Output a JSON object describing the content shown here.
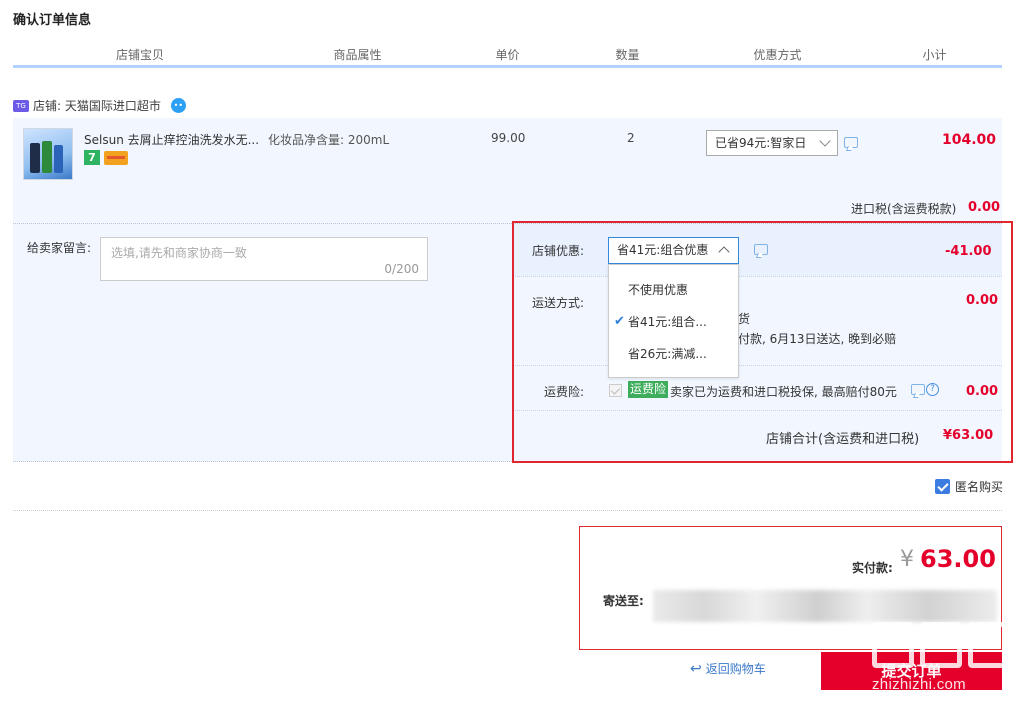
{
  "page": {
    "title": "确认订单信息"
  },
  "columns": [
    "店铺宝贝",
    "商品属性",
    "单价",
    "数量",
    "优惠方式",
    "小计"
  ],
  "shop": {
    "label": "店铺: 天猫国际进口超市",
    "badge_icon": "tmall-global-icon",
    "chat_icon": "wangwang-icon"
  },
  "item": {
    "title": "Selsun 去屑止痒控油洗发水无...",
    "attr": "化妆品净含量: 200mL",
    "price": "99.00",
    "qty": "2",
    "promo": "已省94元:智家日",
    "subtotal": "104.00",
    "tags": [
      "7",
      "card-tag"
    ]
  },
  "tax": {
    "label": "进口税(含运费税款)",
    "value": "0.00"
  },
  "message": {
    "label": "给卖家留言:",
    "placeholder": "选填,请先和商家协商一致",
    "counter": "0/200"
  },
  "shop_panel": {
    "discount_label": "店铺优惠:",
    "discount_selected": "省41元:组合优惠",
    "discount_value": "-41.00",
    "shipping_label": "运送方式:",
    "shipping_value": "0.00",
    "shipping_line1": "货",
    "shipping_line2": "付款, 6月13日送达, 晚到必赔",
    "insurance_label": "运费险:",
    "insurance_badge": "运费险",
    "insurance_text": "卖家已为运费和进口税投保, 最高赔付80元",
    "insurance_value": "0.00",
    "total_label": "店铺合计(含运费和进口税)",
    "total_value": "¥63.00"
  },
  "dropdown": {
    "options": [
      "不使用优惠",
      "省41元:组合...",
      "省26元:满减..."
    ],
    "selected_index": 1
  },
  "anonymous": {
    "label": "匿名购买",
    "checked": true
  },
  "payment": {
    "paid_label": "实付款:",
    "currency": "¥",
    "amount": "63.00",
    "ship_to_label": "寄送至:"
  },
  "actions": {
    "back_label": "返回购物车",
    "submit_label": "提交订单"
  },
  "watermark": {
    "url": "zhizhizhi.com"
  },
  "colors": {
    "accent_red": "#e4002b",
    "frame_red": "#e0262f",
    "row_bg": "#f2f7ff",
    "link_blue": "#3a78c8"
  }
}
